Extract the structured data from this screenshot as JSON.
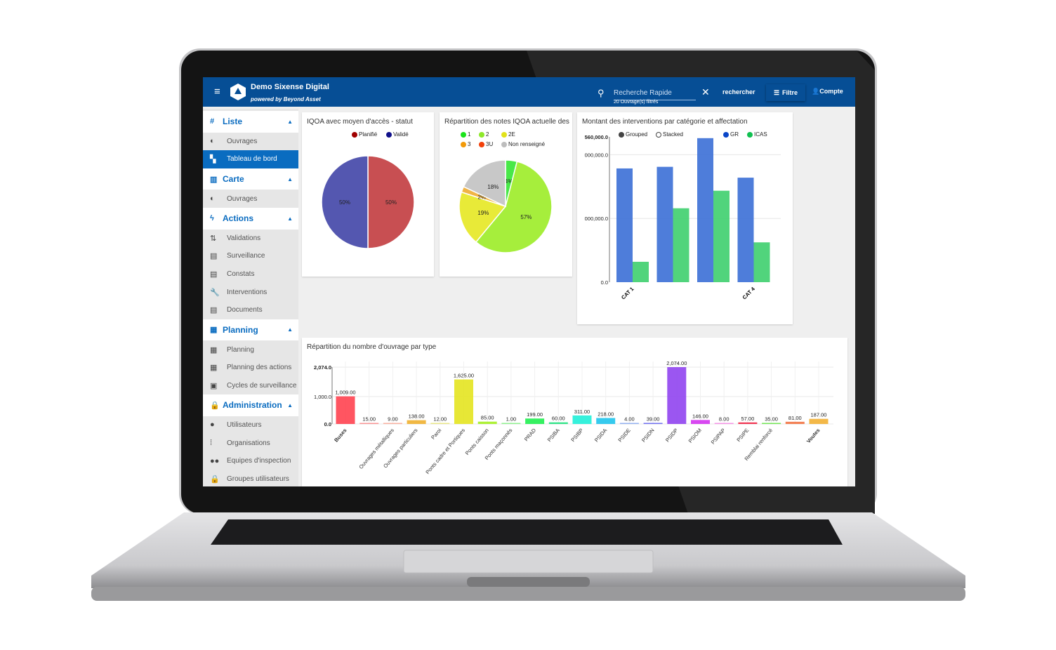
{
  "header": {
    "app_title": "Demo Sixense Digital",
    "subtitle": "powered by Beyond Asset",
    "search_placeholder": "Recherche Rapide",
    "search_hint": "20 Ouvrage(s) filtrés",
    "search_button": "rechercher",
    "filter_button": "Filtre",
    "account_button": "Compte"
  },
  "sidebar": {
    "sections": [
      {
        "label": "Liste",
        "icon": "hash-icon",
        "items": [
          {
            "label": "Ouvrages",
            "icon": "toggle-icon"
          },
          {
            "label": "Tableau de bord",
            "icon": "dashboard-icon",
            "active": true
          }
        ]
      },
      {
        "label": "Carte",
        "icon": "map-icon",
        "items": [
          {
            "label": "Ouvrages",
            "icon": "toggle-icon"
          }
        ]
      },
      {
        "label": "Actions",
        "icon": "bolt-icon",
        "items": [
          {
            "label": "Validations",
            "icon": "swap-icon"
          },
          {
            "label": "Surveillance",
            "icon": "forum-icon"
          },
          {
            "label": "Constats",
            "icon": "note-icon"
          },
          {
            "label": "Interventions",
            "icon": "wrench-icon"
          },
          {
            "label": "Documents",
            "icon": "library-icon"
          }
        ]
      },
      {
        "label": "Planning",
        "icon": "calendar-icon",
        "items": [
          {
            "label": "Planning",
            "icon": "calendar-icon"
          },
          {
            "label": "Planning des actions",
            "icon": "calendar-icon"
          },
          {
            "label": "Cycles de surveillance",
            "icon": "wallet-icon"
          }
        ]
      },
      {
        "label": "Administration",
        "icon": "lock-icon",
        "items": [
          {
            "label": "Utilisateurs",
            "icon": "person-icon"
          },
          {
            "label": "Organisations",
            "icon": "grid-icon"
          },
          {
            "label": "Equipes d'inspection",
            "icon": "group-icon"
          },
          {
            "label": "Groupes utilisateurs",
            "icon": "lock-icon"
          }
        ]
      }
    ]
  },
  "colors": {
    "header": "#064e95",
    "accent": "#0a6cc0"
  },
  "chart_data": [
    {
      "type": "pie",
      "title": "IQOA avec moyen d'accès - statut",
      "legend": [
        {
          "name": "Planifié",
          "color": "#a00000"
        },
        {
          "name": "Validé",
          "color": "#10108a"
        }
      ],
      "slices": [
        {
          "name": "Planifié",
          "value": 50,
          "label": "50%",
          "color": "#c84f52"
        },
        {
          "name": "Validé",
          "value": 50,
          "label": "50%",
          "color": "#5457b0"
        }
      ]
    },
    {
      "type": "pie",
      "title": "Répartition des notes IQOA actuelle des o",
      "legend": [
        {
          "name": "1",
          "color": "#1be31b"
        },
        {
          "name": "2",
          "color": "#8ee82a"
        },
        {
          "name": "2E",
          "color": "#e2e21a"
        },
        {
          "name": "3",
          "color": "#f29a0a"
        },
        {
          "name": "3U",
          "color": "#f2400a"
        },
        {
          "name": "Non renseigné",
          "color": "#bdbdbd"
        }
      ],
      "slices": [
        {
          "name": "1",
          "value": 4,
          "label": "4%",
          "color": "#48e848"
        },
        {
          "name": "2",
          "value": 57,
          "label": "57%",
          "color": "#a6ee3c"
        },
        {
          "name": "2E",
          "value": 19,
          "label": "19%",
          "color": "#e8ea38"
        },
        {
          "name": "3",
          "value": 2,
          "label": "2%",
          "color": "#f0b445"
        },
        {
          "name": "3U",
          "value": 0,
          "label": "",
          "color": "#f2400a"
        },
        {
          "name": "Non renseigné",
          "value": 18,
          "label": "18%",
          "color": "#c8c8c8"
        }
      ]
    },
    {
      "type": "bar",
      "title": "Montant des interventions par catégorie et affectation",
      "mode_options": [
        {
          "label": "Grouped",
          "selected": true
        },
        {
          "label": "Stacked",
          "selected": false
        }
      ],
      "categories": [
        "CAT 1",
        "",
        "",
        "CAT 4"
      ],
      "ylim": [
        0,
        4560000
      ],
      "yticks": [
        {
          "value": 0,
          "label": "0.0"
        },
        {
          "value": 2000000,
          "label": "000,000.0"
        },
        {
          "value": 4000000,
          "label": "000,000.0"
        },
        {
          "value": 4560000,
          "label": "560,000.0"
        }
      ],
      "grid": true,
      "legend_position": "top-right",
      "series": [
        {
          "name": "GR",
          "color": "#3b6fd6",
          "values": [
            3570000,
            3620000,
            4520000,
            3280000
          ]
        },
        {
          "name": "ICAS",
          "color": "#3ecf6e",
          "values": [
            640000,
            2320000,
            2870000,
            1250000
          ]
        }
      ]
    },
    {
      "type": "bar",
      "title": "Répartition du nombre d'ouvrage par type",
      "ylim": [
        0,
        2074
      ],
      "yticks": [
        {
          "value": 0,
          "label": "0.0"
        },
        {
          "value": 1000,
          "label": "1,000.0"
        },
        {
          "value": 2074,
          "label": "2,074.0"
        }
      ],
      "grid": true,
      "categories": [
        "Buses",
        "",
        "Ouvrages métalliques",
        "Ouvrages particuliers",
        "Paroi",
        "Ponts cadre et Portiques",
        "Ponts caisson",
        "Ponts maçonnés",
        "PRAD",
        "PSIBA",
        "PSIBP",
        "PSIDA",
        "PSIDE",
        "PSIDN",
        "PSIDP",
        "PSIOM",
        "PSIPAP",
        "PSIPE",
        "Remblai renforcé",
        "",
        "Voutes"
      ],
      "values": [
        1009,
        15,
        9,
        138,
        12,
        1625,
        85,
        1,
        199,
        60,
        311,
        218,
        4,
        39,
        2074,
        146,
        8,
        57,
        35,
        81,
        187
      ],
      "data_labels": [
        "1,009.00",
        "15.00",
        "9.00",
        "138.00",
        "12.00",
        "1,625.00",
        "85.00",
        "1.00",
        "199.00",
        "60.00",
        "311.00",
        "218.00",
        "4.00",
        "39.00",
        "2,074.00",
        "146.00",
        "8.00",
        "57.00",
        "35.00",
        "81.00",
        "187.00"
      ],
      "colors": [
        "#ff4250",
        "#f88a8a",
        "#f8a898",
        "#f0b030",
        "#e8e47a",
        "#e4e420",
        "#a4f020",
        "#84f084",
        "#20f050",
        "#20e27e",
        "#20f0d8",
        "#20c4ec",
        "#88aaf0",
        "#6464f0",
        "#9044f0",
        "#d434f0",
        "#f488e4",
        "#f02444",
        "#64e444",
        "#f27444",
        "#f2b034"
      ]
    }
  ]
}
